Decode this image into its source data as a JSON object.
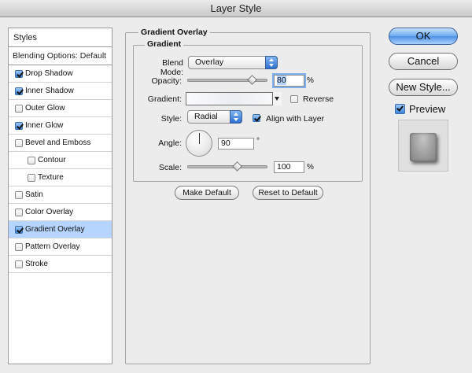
{
  "window": {
    "title": "Layer Style"
  },
  "styles": {
    "header": "Styles",
    "blending_options": "Blending Options: Default",
    "items": [
      {
        "label": "Drop Shadow",
        "checked": true,
        "sub": false,
        "selected": false
      },
      {
        "label": "Inner Shadow",
        "checked": true,
        "sub": false,
        "selected": false
      },
      {
        "label": "Outer Glow",
        "checked": false,
        "sub": false,
        "selected": false
      },
      {
        "label": "Inner Glow",
        "checked": true,
        "sub": false,
        "selected": false
      },
      {
        "label": "Bevel and Emboss",
        "checked": false,
        "sub": false,
        "selected": false
      },
      {
        "label": "Contour",
        "checked": false,
        "sub": true,
        "selected": false
      },
      {
        "label": "Texture",
        "checked": false,
        "sub": true,
        "selected": false
      },
      {
        "label": "Satin",
        "checked": false,
        "sub": false,
        "selected": false
      },
      {
        "label": "Color Overlay",
        "checked": false,
        "sub": false,
        "selected": false
      },
      {
        "label": "Gradient Overlay",
        "checked": true,
        "sub": false,
        "selected": true
      },
      {
        "label": "Pattern Overlay",
        "checked": false,
        "sub": false,
        "selected": false
      },
      {
        "label": "Stroke",
        "checked": false,
        "sub": false,
        "selected": false
      }
    ]
  },
  "gradient_overlay": {
    "section_title": "Gradient Overlay",
    "group_title": "Gradient",
    "blend_mode_label": "Blend Mode:",
    "blend_mode_value": "Overlay",
    "opacity_label": "Opacity:",
    "opacity_value": "80",
    "opacity_fraction": 0.8,
    "percent": "%",
    "gradient_label": "Gradient:",
    "reverse_label": "Reverse",
    "reverse_checked": false,
    "style_label": "Style:",
    "style_value": "Radial",
    "align_label": "Align with Layer",
    "align_checked": true,
    "angle_label": "Angle:",
    "angle_value": "90",
    "degree": "°",
    "scale_label": "Scale:",
    "scale_value": "100",
    "make_default": "Make Default",
    "reset_default": "Reset to Default"
  },
  "buttons": {
    "ok": "OK",
    "cancel": "Cancel",
    "new_style": "New Style...",
    "preview_label": "Preview",
    "preview_checked": true
  }
}
